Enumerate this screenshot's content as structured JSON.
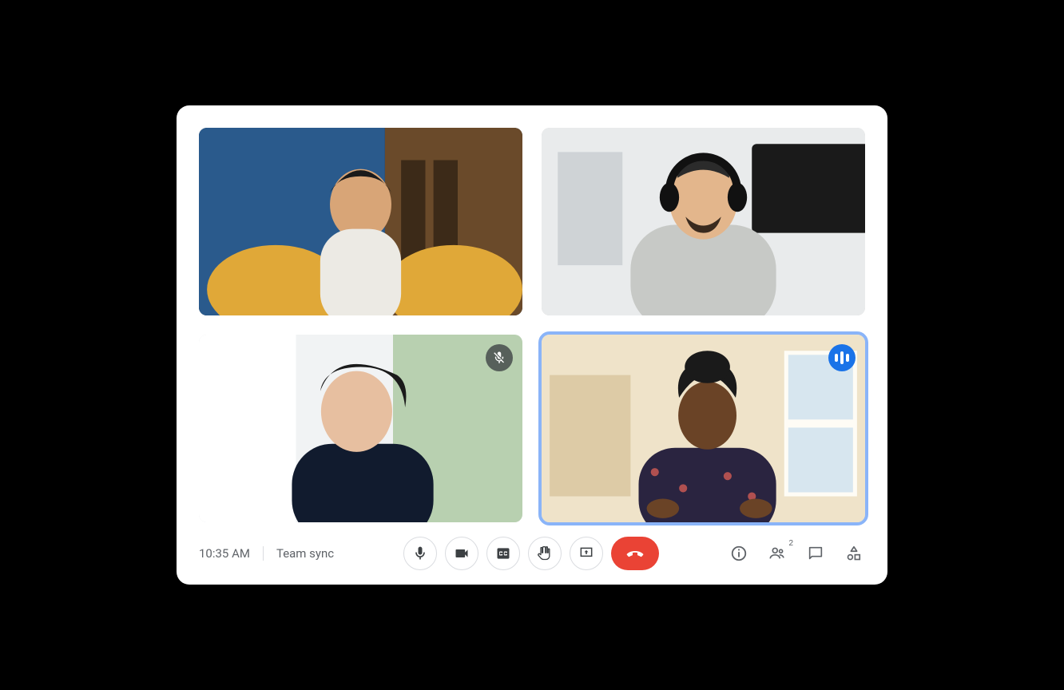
{
  "meeting": {
    "time": "10:35 AM",
    "title": "Team sync",
    "participant_count": "2"
  },
  "participants": [
    {
      "id": "p1",
      "muted": false,
      "speaking": false
    },
    {
      "id": "p2",
      "muted": false,
      "speaking": false
    },
    {
      "id": "p3",
      "muted": true,
      "speaking": false
    },
    {
      "id": "p4",
      "muted": false,
      "speaking": true
    }
  ],
  "controls": {
    "mic": "Microphone",
    "camera": "Camera",
    "captions": "Captions",
    "raise_hand": "Raise hand",
    "present": "Present screen",
    "hangup": "Leave call",
    "info": "Meeting details",
    "people": "People",
    "chat": "Chat",
    "activities": "Activities"
  },
  "colors": {
    "accent": "#1a73e8",
    "speaking_ring": "#8ab4f8",
    "hangup": "#ea4335",
    "icon": "#5f6368"
  }
}
